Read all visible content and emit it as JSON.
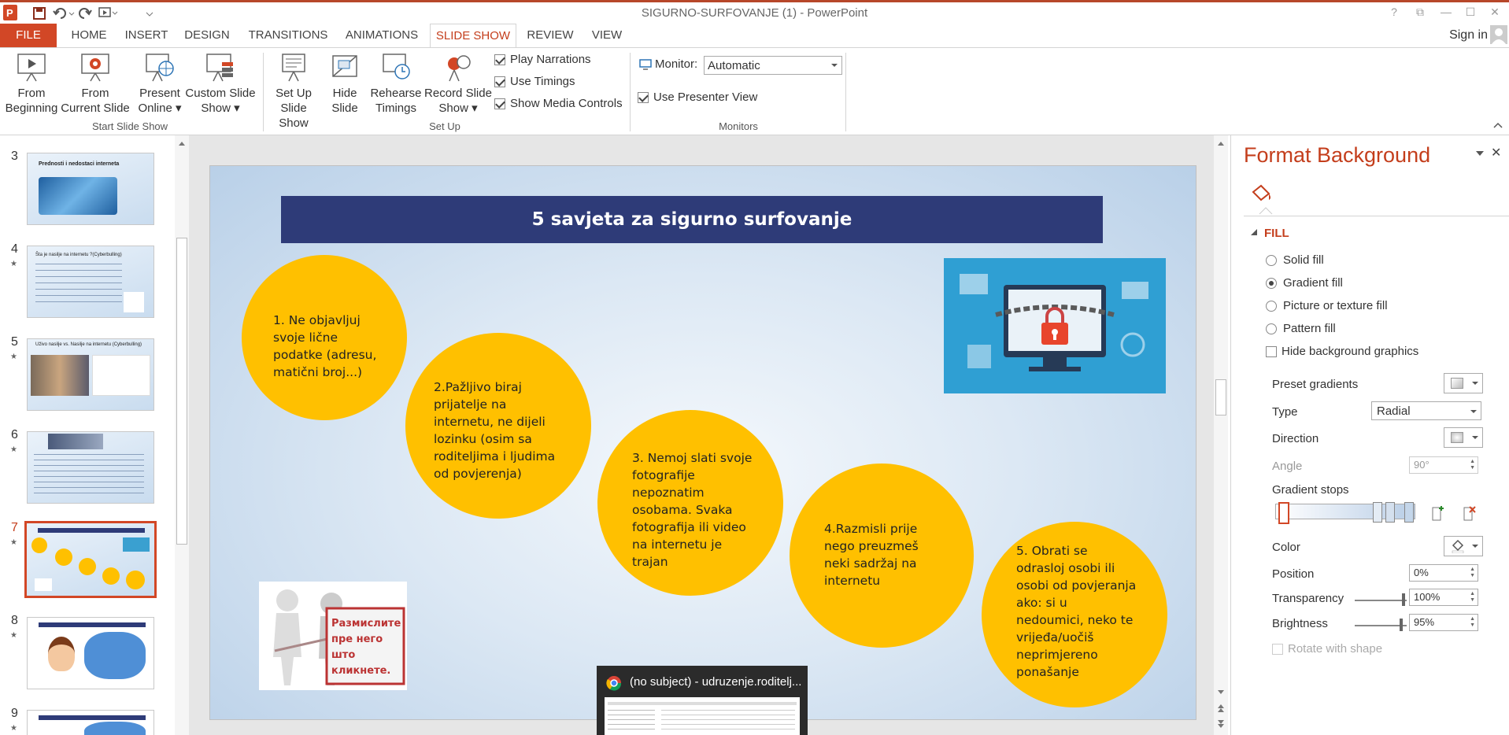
{
  "window": {
    "title": "SIGURNO-SURFOVANJE (1) - PowerPoint",
    "help": "?",
    "restore": "⧉",
    "minimize": "—",
    "maximize": "☐",
    "close": "✕"
  },
  "tabs": [
    "FILE",
    "HOME",
    "INSERT",
    "DESIGN",
    "TRANSITIONS",
    "ANIMATIONS",
    "SLIDE SHOW",
    "REVIEW",
    "VIEW"
  ],
  "active_tab": "SLIDE SHOW",
  "sign_in": "Sign in",
  "ribbon": {
    "start": {
      "from_beginning": [
        "From",
        "Beginning"
      ],
      "from_current": [
        "From",
        "Current Slide"
      ],
      "present_online": [
        "Present",
        "Online ▾"
      ],
      "custom_show": [
        "Custom Slide",
        "Show ▾"
      ],
      "group_label": "Start Slide Show"
    },
    "setup": {
      "setup_show": [
        "Set Up",
        "Slide Show"
      ],
      "hide_slide": [
        "Hide",
        "Slide"
      ],
      "rehearse": [
        "Rehearse",
        "Timings"
      ],
      "record": [
        "Record Slide",
        "Show ▾"
      ],
      "play_narrations": "Play Narrations",
      "use_timings": "Use Timings",
      "show_media": "Show Media Controls",
      "group_label": "Set Up"
    },
    "monitors": {
      "monitor_label": "Monitor:",
      "monitor_value": "Automatic",
      "presenter_view": "Use Presenter View",
      "group_label": "Monitors"
    }
  },
  "thumbnails": [
    {
      "num": "3",
      "title": "Prednosti i nedostaci interneta",
      "star": false
    },
    {
      "num": "4",
      "title": "Šta je nasilje na internetu ?(Cyberbulling)",
      "star": true
    },
    {
      "num": "5",
      "title": "Uživo nasilje vs. Nasilje na internetu (Cyberbulling)",
      "star": true
    },
    {
      "num": "6",
      "title": "",
      "star": true
    },
    {
      "num": "7",
      "title": "5 savjeta za sigurno surfovanje",
      "star": true,
      "active": true
    },
    {
      "num": "8",
      "title": "",
      "star": true
    },
    {
      "num": "9",
      "title": "",
      "star": true
    }
  ],
  "slide": {
    "title": "5 savjeta za sigurno surfovanje",
    "tips": [
      "1. Ne objavljuj svoje lične podatke (adresu, matični broj...)",
      "2.Pažljivo biraj prijatelje na internetu, ne dijeli lozinku (osim sa roditeljima i ljudima od povjerenja)",
      "3. Nemoj slati svoje fotografije nepoznatim osobama. Svaka fotografija ili video na internetu je trajan",
      "4.Razmisli prije nego preuzmeš neki sadržaj na internetu",
      "5. Obrati se odrasloj osobi ili osobi od povjeranja ako: si u nedoumici, neko te vrijeđa/uočiš neprimjereno ponašanje"
    ],
    "tip_lines": [
      [
        "1. Ne objavljuj",
        "svoje lične",
        "podatke (adresu,",
        "matični broj...)"
      ],
      [
        "2.Pažljivo biraj",
        "prijatelje na",
        "internetu, ne dijeli",
        "lozinku (osim sa",
        "roditeljima i ljudima",
        "od povjerenja)"
      ],
      [
        "3. Nemoj slati svoje",
        "fotografije",
        "nepoznatim",
        "osobama. Svaka",
        "fotografija ili video",
        "na internetu je",
        "trajan"
      ],
      [
        "4.Razmisli prije",
        "nego preuzmeš",
        "neki sadržaj na",
        "internetu"
      ],
      [
        "5. Obrati se",
        "odrasloj osobi ili",
        "osobi od povjeranja",
        "ako: si u",
        "nedoumici, neko te",
        "vrijeđa/uočiš",
        "neprimjereno",
        "ponašanje"
      ]
    ],
    "sign_text": [
      "Размислите",
      "пре него што",
      "кликнете."
    ]
  },
  "taskbar_preview": {
    "title": "(no subject) - udruzenje.roditelj..."
  },
  "format_pane": {
    "title": "Format Background",
    "section": "FILL",
    "options": [
      "Solid fill",
      "Gradient fill",
      "Picture or texture fill",
      "Pattern fill"
    ],
    "selected_option": "Gradient fill",
    "hide_bg": "Hide background graphics",
    "preset_gradients": "Preset gradients",
    "type_label": "Type",
    "type_value": "Radial",
    "direction_label": "Direction",
    "angle_label": "Angle",
    "angle_value": "90°",
    "gradient_stops": "Gradient stops",
    "color_label": "Color",
    "position_label": "Position",
    "position_value": "0%",
    "transparency_label": "Transparency",
    "transparency_value": "100%",
    "brightness_label": "Brightness",
    "brightness_value": "95%",
    "rotate_label": "Rotate with shape"
  },
  "colors": {
    "accent": "#d24726",
    "tab_active": "#c43e1c",
    "slide_title_bg": "#2e3b78",
    "tip_circle": "#ffc000"
  }
}
